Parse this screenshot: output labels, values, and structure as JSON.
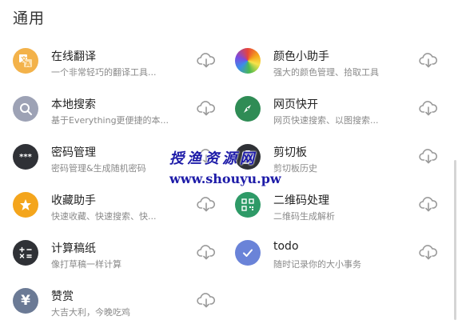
{
  "section": {
    "title": "通用"
  },
  "colors": {
    "translate": "#f3b24a",
    "search": "#9da2b5",
    "password": "#2f3136",
    "favorite": "#f4a51c",
    "calc": "#2f3136",
    "reward": "#6b7a95",
    "color": "#e8443a",
    "web": "#2f8c55",
    "clipboard": "#2f3136",
    "qr": "#2e9a67",
    "todo": "#6a83d8",
    "download": "#9a9a9a"
  },
  "items": [
    {
      "title": "在线翻译",
      "desc": "一个非常轻巧的翻译工具...",
      "icon": "translate-icon",
      "glyph": "文"
    },
    {
      "title": "颜色小助手",
      "desc": "强大的颜色管理、拾取工具",
      "icon": "color-wheel-icon",
      "glyph": ""
    },
    {
      "title": "本地搜索",
      "desc": "基于Everything更便捷的本...",
      "icon": "search-icon",
      "glyph": ""
    },
    {
      "title": "网页快开",
      "desc": "网页快速搜索、以图搜索...",
      "icon": "compass-icon",
      "glyph": ""
    },
    {
      "title": "密码管理",
      "desc": "密码管理&生成随机密码",
      "icon": "password-icon",
      "glyph": "***"
    },
    {
      "title": "剪切板",
      "desc": "剪切板历史",
      "icon": "clipboard-icon",
      "glyph": ""
    },
    {
      "title": "收藏助手",
      "desc": "快速收藏、快速搜索、快...",
      "icon": "star-icon",
      "glyph": ""
    },
    {
      "title": "二维码处理",
      "desc": "二维码生成解析",
      "icon": "qr-code-icon",
      "glyph": ""
    },
    {
      "title": "计算稿纸",
      "desc": "像打草稿一样计算",
      "icon": "calculator-icon",
      "glyph": ""
    },
    {
      "title": "todo",
      "desc": "随时记录你的大小事务",
      "icon": "check-icon",
      "glyph": ""
    },
    {
      "title": "赞赏",
      "desc": "大吉大利，今晚吃鸡",
      "icon": "yen-icon",
      "glyph": "¥"
    }
  ],
  "watermark": {
    "cn": "授渔资源网",
    "url": "www.shouyu.pw"
  }
}
